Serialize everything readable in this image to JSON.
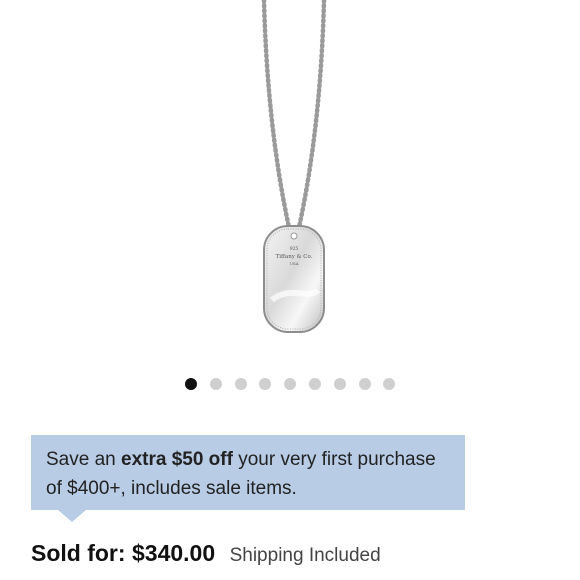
{
  "product": {
    "image_alt": "Tiffany & Co. silver dog tag pendant on bead chain",
    "tag_text": [
      "925",
      "Tiffany & Co.",
      "USA"
    ]
  },
  "carousel": {
    "total": 9,
    "active_index": 0
  },
  "promo": {
    "prefix": "Save an ",
    "highlight": "extra $50 off",
    "suffix": " your very first purchase of $400+, includes sale items."
  },
  "pricing": {
    "label": "Sold for:",
    "value": "$340.00",
    "shipping": "Shipping Included"
  },
  "colors": {
    "promo_bg": "#b8cce6",
    "dot_active": "#111111",
    "dot_inactive": "#cfcfcf"
  }
}
